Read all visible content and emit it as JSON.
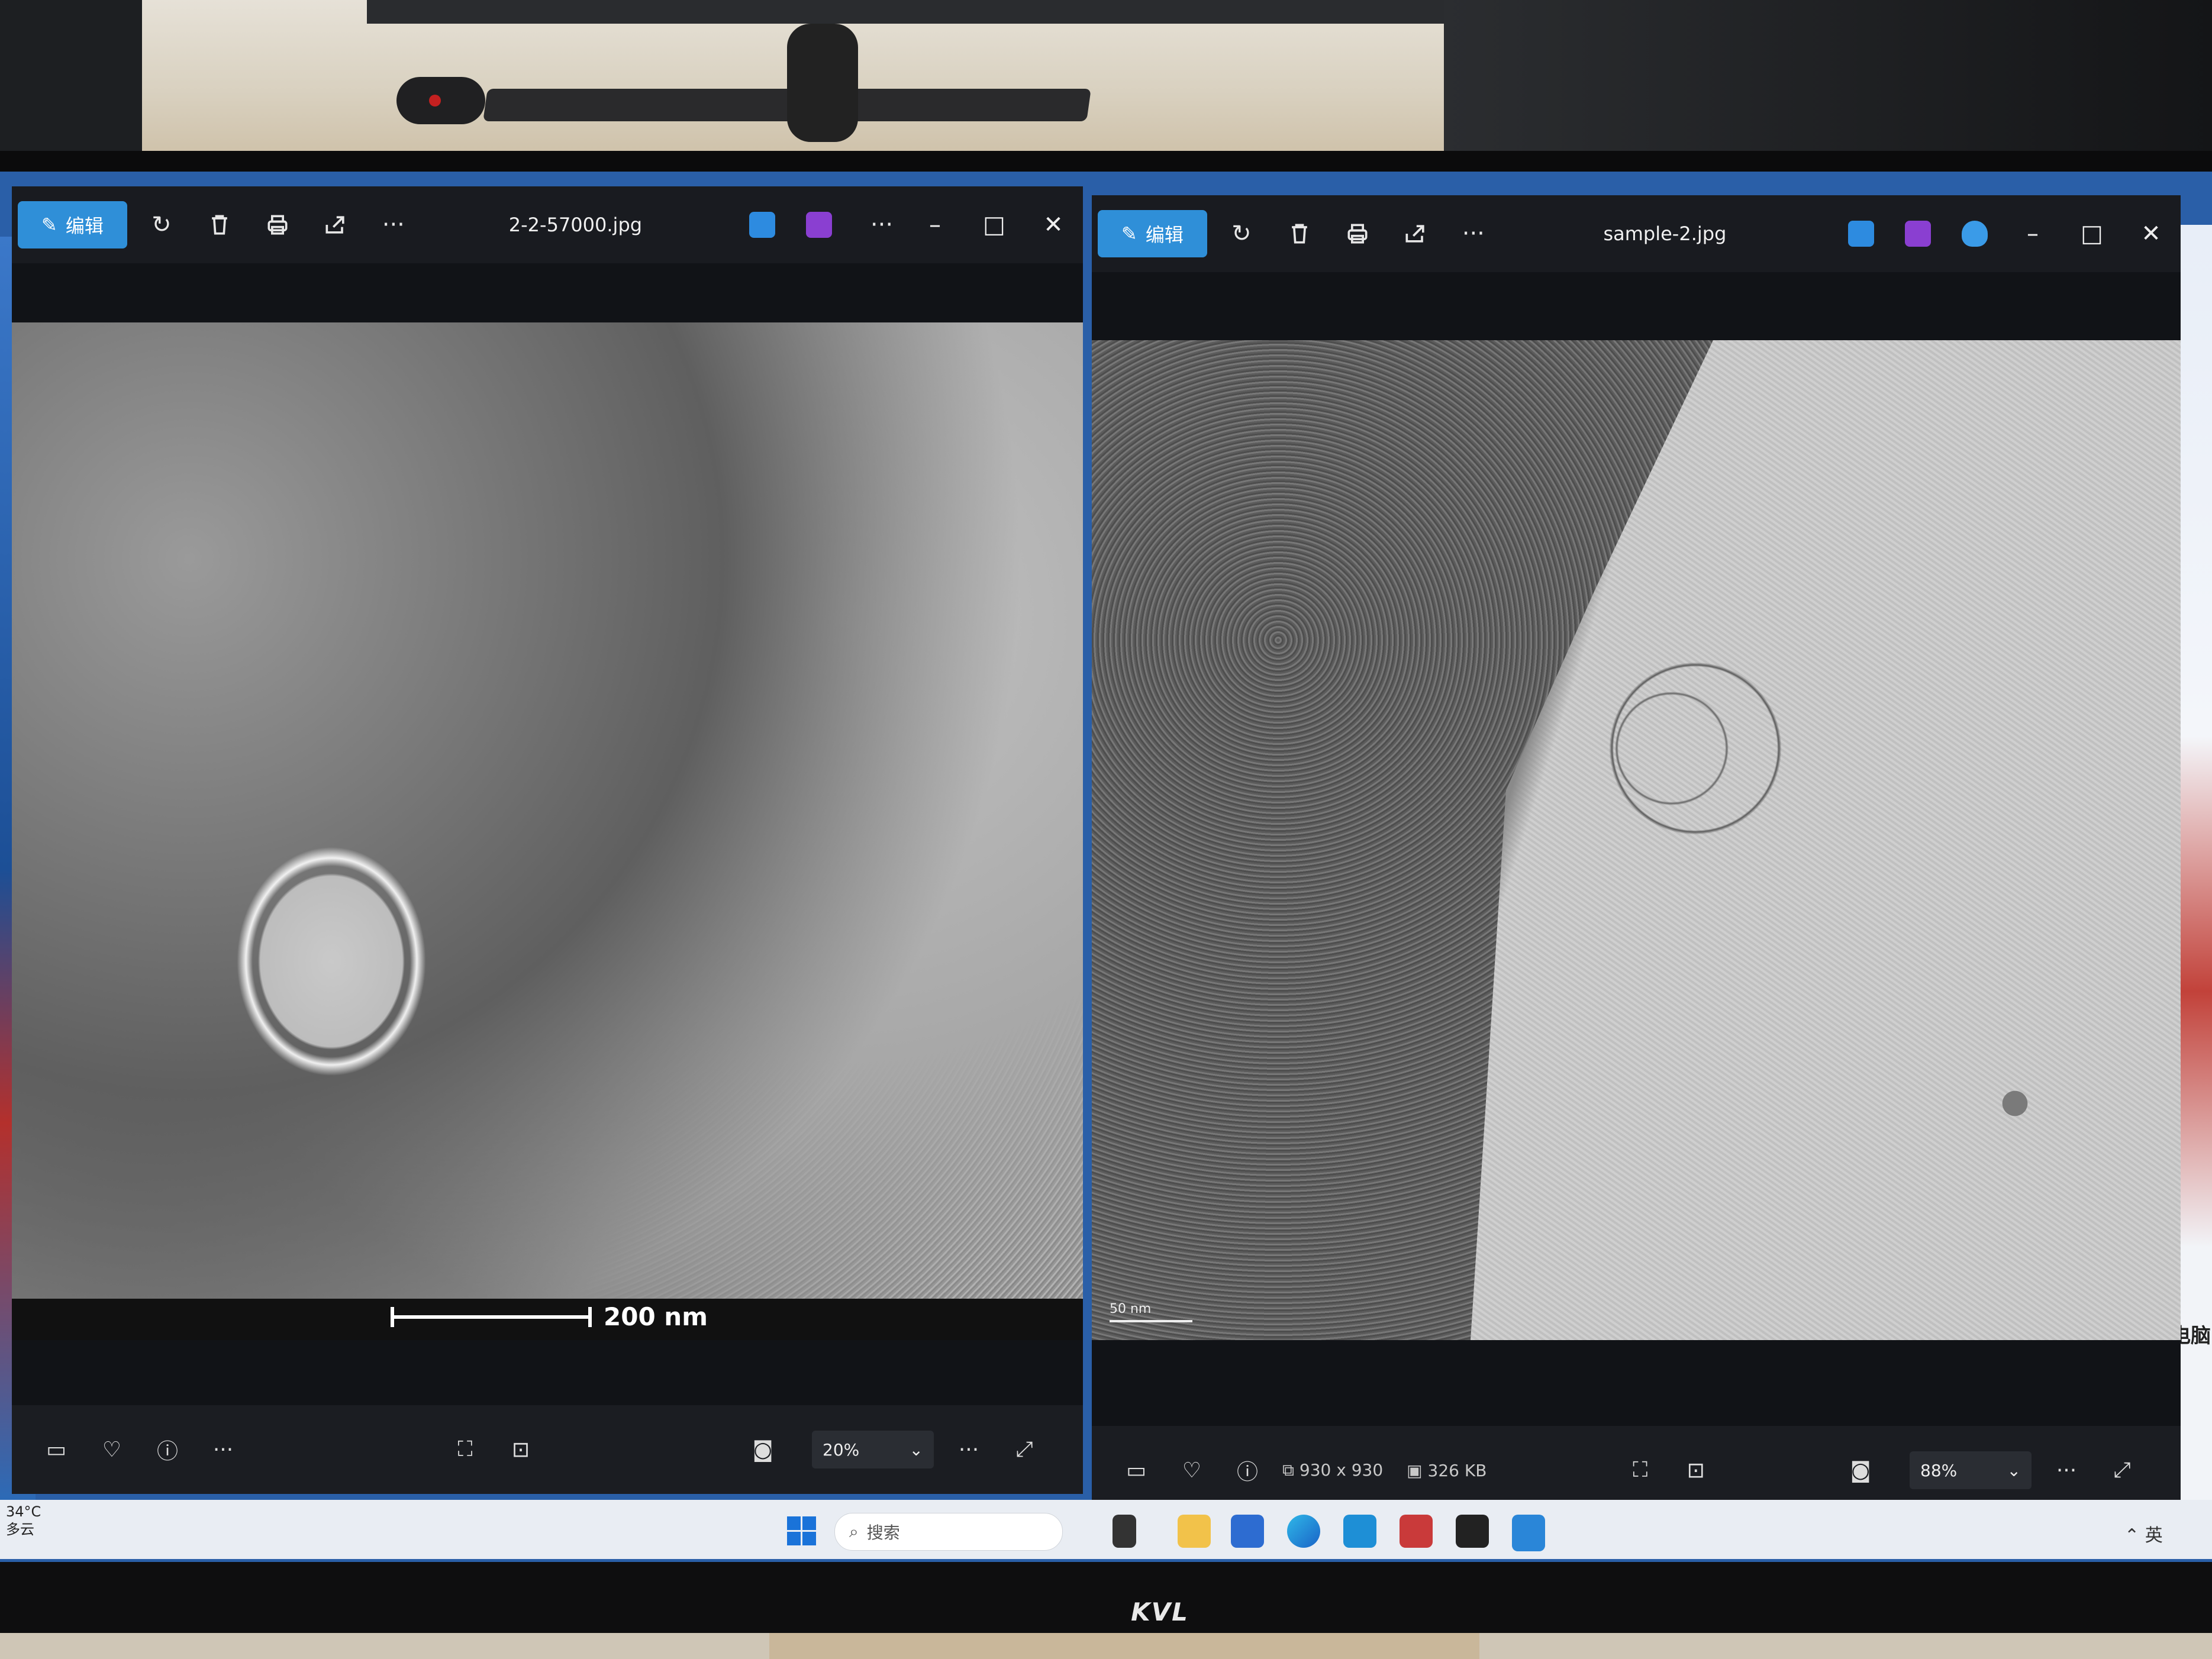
{
  "window_left": {
    "edit_label": "编辑",
    "title": "2-2-57000.jpg",
    "scale_label": "200 nm",
    "zoom": "20%"
  },
  "window_right": {
    "edit_label": "编辑",
    "title": "sample-2.jpg",
    "dimensions": "930 x 930",
    "file_size": "326 KB",
    "zoom": "88%",
    "scale_label": "50 nm"
  },
  "taskbar": {
    "temperature": "34°C",
    "weather": "多云",
    "search_placeholder": "搜索",
    "ime": "英"
  },
  "desktop": {
    "right_label": "电脑"
  },
  "monitor": {
    "brand": "KVL"
  },
  "colors": {
    "accent": "#2f8fd8",
    "titlebar": "#191b20",
    "taskbar": "#e9edf3"
  }
}
